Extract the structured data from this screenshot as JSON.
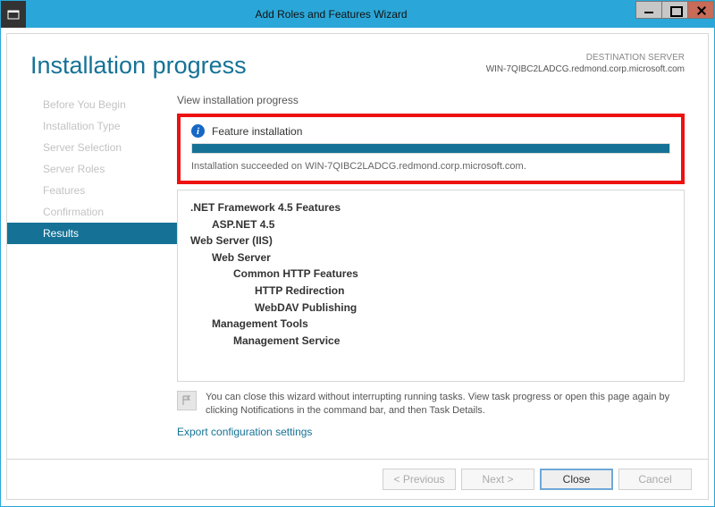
{
  "window": {
    "title": "Add Roles and Features Wizard"
  },
  "header": {
    "page_title": "Installation progress",
    "dest_label": "DESTINATION SERVER",
    "dest_server": "WIN-7QIBC2LADCG.redmond.corp.microsoft.com"
  },
  "nav": {
    "items": [
      {
        "label": "Before You Begin"
      },
      {
        "label": "Installation Type"
      },
      {
        "label": "Server Selection"
      },
      {
        "label": "Server Roles"
      },
      {
        "label": "Features"
      },
      {
        "label": "Confirmation"
      },
      {
        "label": "Results",
        "active": true
      }
    ]
  },
  "content": {
    "view_label": "View installation progress",
    "box": {
      "title": "Feature installation",
      "progress_percent": 100,
      "message": "Installation succeeded on WIN-7QIBC2LADCG.redmond.corp.microsoft.com."
    },
    "tree": [
      {
        "text": ".NET Framework 4.5 Features",
        "bold": true,
        "indent": 0
      },
      {
        "text": "ASP.NET 4.5",
        "bold": true,
        "indent": 1
      },
      {
        "text": "Web Server (IIS)",
        "bold": true,
        "indent": 0
      },
      {
        "text": "Web Server",
        "bold": true,
        "indent": 1
      },
      {
        "text": "Common HTTP Features",
        "bold": true,
        "indent": 2
      },
      {
        "text": "HTTP Redirection",
        "bold": true,
        "indent": 3
      },
      {
        "text": "WebDAV Publishing",
        "bold": true,
        "indent": 3
      },
      {
        "text": "Management Tools",
        "bold": true,
        "indent": 1
      },
      {
        "text": "Management Service",
        "bold": true,
        "indent": 2
      }
    ],
    "note": "You can close this wizard without interrupting running tasks. View task progress or open this page again by clicking Notifications in the command bar, and then Task Details.",
    "export_link": "Export configuration settings"
  },
  "footer": {
    "previous": "< Previous",
    "next": "Next >",
    "close": "Close",
    "cancel": "Cancel"
  }
}
